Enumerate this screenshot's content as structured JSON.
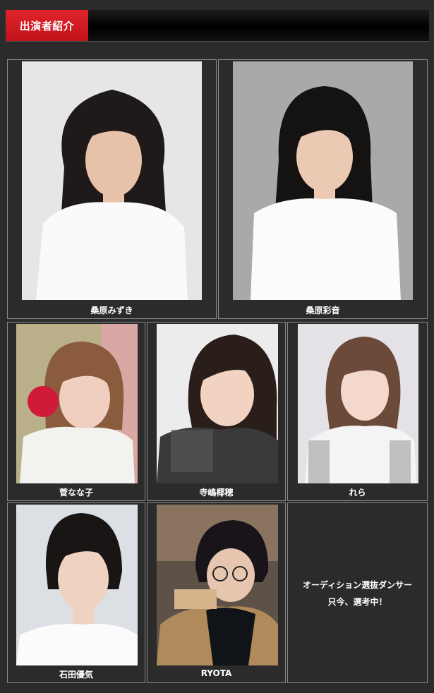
{
  "header": {
    "title": "出演者紹介",
    "accent_color": "#d01a21"
  },
  "performers": [
    {
      "name": "桑原みずき"
    },
    {
      "name": "桑原彩音"
    },
    {
      "name": "菅なな子"
    },
    {
      "name": "寺嶋椰穂"
    },
    {
      "name": "れら"
    },
    {
      "name": "石田優気"
    },
    {
      "name": "RYOTA"
    }
  ],
  "audition": {
    "line1": "オーディション選抜ダンサー",
    "line2": "只今、選考中！"
  }
}
